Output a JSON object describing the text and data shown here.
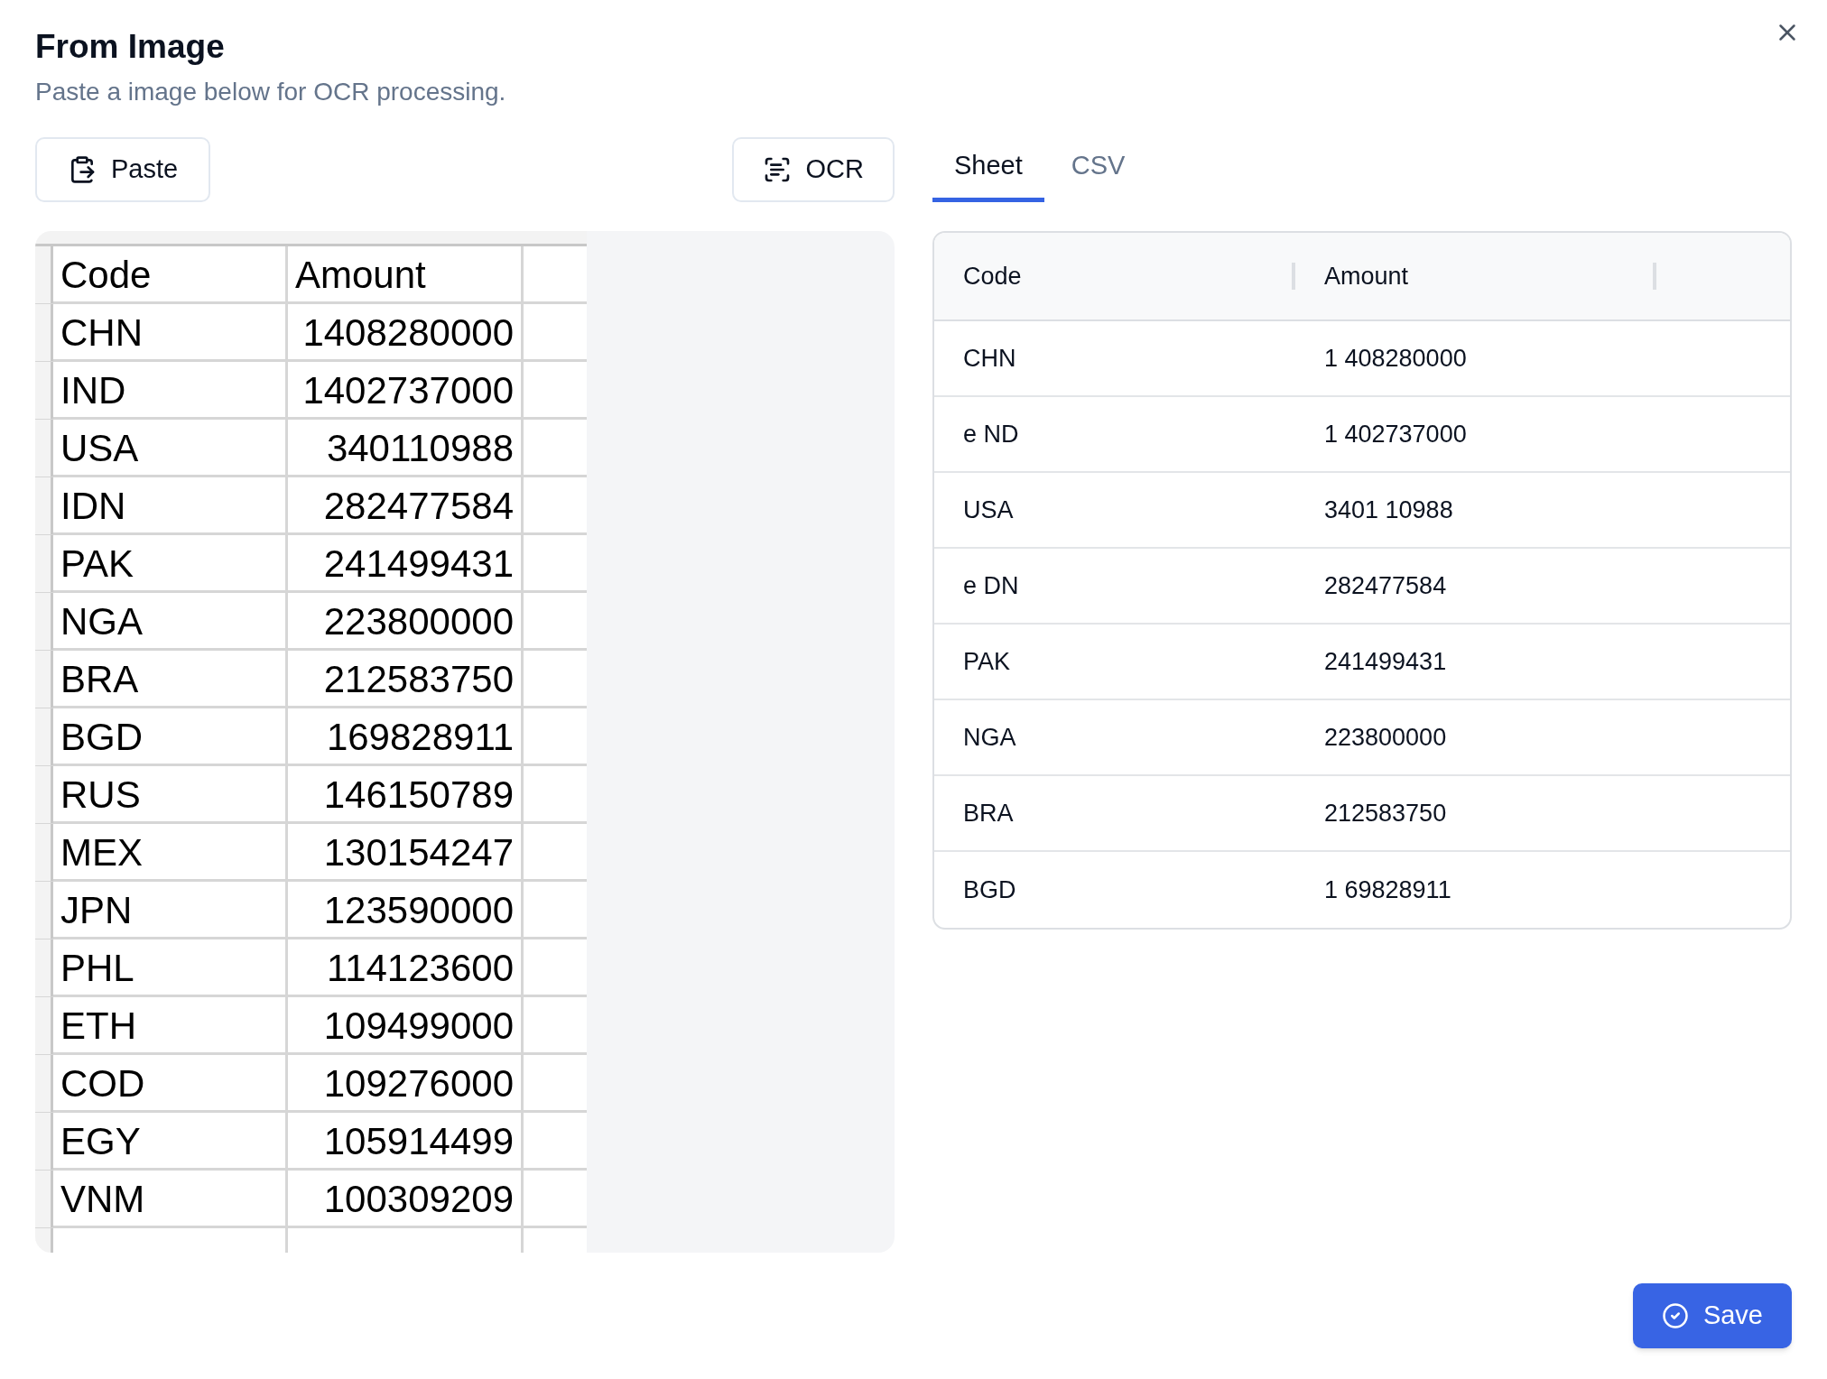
{
  "dialog": {
    "title": "From Image",
    "description": "Paste a image below for OCR processing."
  },
  "toolbar": {
    "paste_button": "Paste",
    "ocr_button": "OCR"
  },
  "tabs": [
    {
      "label": "Sheet",
      "selected": true
    },
    {
      "label": "CSV",
      "selected": false
    }
  ],
  "pasted_image": {
    "columns": [
      "Code",
      "Amount"
    ],
    "rows": [
      [
        "CHN",
        "1408280000"
      ],
      [
        "IND",
        "1402737000"
      ],
      [
        "USA",
        "340110988"
      ],
      [
        "IDN",
        "282477584"
      ],
      [
        "PAK",
        "241499431"
      ],
      [
        "NGA",
        "223800000"
      ],
      [
        "BRA",
        "212583750"
      ],
      [
        "BGD",
        "169828911"
      ],
      [
        "RUS",
        "146150789"
      ],
      [
        "MEX",
        "130154247"
      ],
      [
        "JPN",
        "123590000"
      ],
      [
        "PHL",
        "114123600"
      ],
      [
        "ETH",
        "109499000"
      ],
      [
        "COD",
        "109276000"
      ],
      [
        "EGY",
        "105914499"
      ],
      [
        "VNM",
        "100309209"
      ]
    ]
  },
  "sheet": {
    "columns": [
      "Code",
      "Amount"
    ],
    "rows": [
      [
        "CHN",
        "1 408280000"
      ],
      [
        "e ND",
        "1 402737000"
      ],
      [
        "USA",
        "3401 10988"
      ],
      [
        "e DN",
        "282477584"
      ],
      [
        "PAK",
        "241499431"
      ],
      [
        "NGA",
        "223800000"
      ],
      [
        "BRA",
        "212583750"
      ],
      [
        "BGD",
        "1 69828911"
      ]
    ]
  },
  "save_button": "Save"
}
